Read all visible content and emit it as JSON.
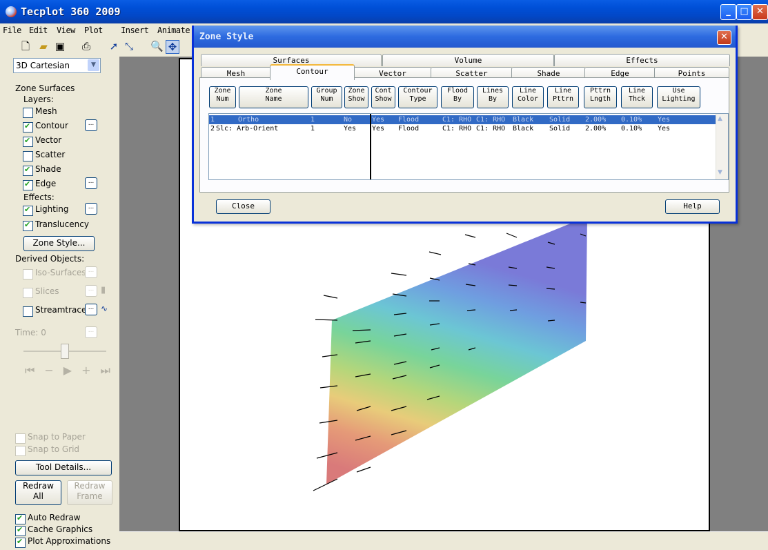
{
  "app": {
    "title": "Tecplot 360 2009"
  },
  "menu": [
    "File",
    "Edit",
    "View",
    "Plot",
    "Insert",
    "Animate"
  ],
  "sidebar": {
    "plot_type": "3D Cartesian",
    "zone_surfaces": "Zone Surfaces",
    "layers_label": "Layers:",
    "layers": [
      {
        "label": "Mesh",
        "checked": false
      },
      {
        "label": "Contour",
        "checked": true
      },
      {
        "label": "Vector",
        "checked": true
      },
      {
        "label": "Scatter",
        "checked": false
      },
      {
        "label": "Shade",
        "checked": true
      },
      {
        "label": "Edge",
        "checked": true
      }
    ],
    "effects_label": "Effects:",
    "effects": [
      {
        "label": "Lighting",
        "checked": true
      },
      {
        "label": "Translucency",
        "checked": true
      }
    ],
    "zone_style_button": "Zone Style...",
    "derived_label": "Derived Objects:",
    "derived": [
      {
        "label": "Iso-Surfaces",
        "enabled": false
      },
      {
        "label": "Slices",
        "enabled": false
      },
      {
        "label": "Streamtraces",
        "enabled": true
      }
    ],
    "time_label": "Time: 0",
    "snap_paper": "Snap to Paper",
    "snap_grid": "Snap to Grid",
    "tool_details": "Tool Details...",
    "redraw_all": [
      "Redraw",
      "All"
    ],
    "redraw_frame": [
      "Redraw",
      "Frame"
    ],
    "options": [
      {
        "label": "Auto Redraw",
        "checked": true
      },
      {
        "label": "Cache Graphics",
        "checked": true
      },
      {
        "label": "Plot Approximations",
        "checked": true
      }
    ]
  },
  "dialog": {
    "title": "Zone Style",
    "tab_groups": [
      "Surfaces",
      "Volume",
      "Effects"
    ],
    "tabs": [
      "Mesh",
      "Contour",
      "Vector",
      "Scatter",
      "Shade",
      "Edge",
      "Points"
    ],
    "active_tab": "Contour",
    "columns": [
      [
        "Zone",
        "Num"
      ],
      [
        "Zone",
        "Name"
      ],
      [
        "Group",
        "Num"
      ],
      [
        "Zone",
        "Show"
      ],
      [
        "Cont",
        "Show"
      ],
      [
        "Contour",
        "Type"
      ],
      [
        "Flood",
        "By"
      ],
      [
        "Lines",
        "By"
      ],
      [
        "Line",
        "Color"
      ],
      [
        "Line",
        "Pttrn"
      ],
      [
        "Pttrn",
        "Lngth"
      ],
      [
        "Line",
        "Thck"
      ],
      [
        "Use",
        "Lighting"
      ]
    ],
    "rows": [
      [
        "1",
        "Ortho",
        "1",
        "No",
        "Yes",
        "Flood",
        "C1: RHO",
        "C1: RHO",
        "Black",
        "Solid",
        "2.00%",
        "0.10%",
        "Yes"
      ],
      [
        "2",
        "Slc: Arb-Orient",
        "1",
        "Yes",
        "Yes",
        "Flood",
        "C1: RHO",
        "C1: RHO",
        "Black",
        "Solid",
        "2.00%",
        "0.10%",
        "Yes"
      ]
    ],
    "close_button": "Close",
    "help_button": "Help"
  },
  "colors": {
    "titlebar": "#0050d8",
    "selection": "#316ac5",
    "workspace": "#808080"
  }
}
